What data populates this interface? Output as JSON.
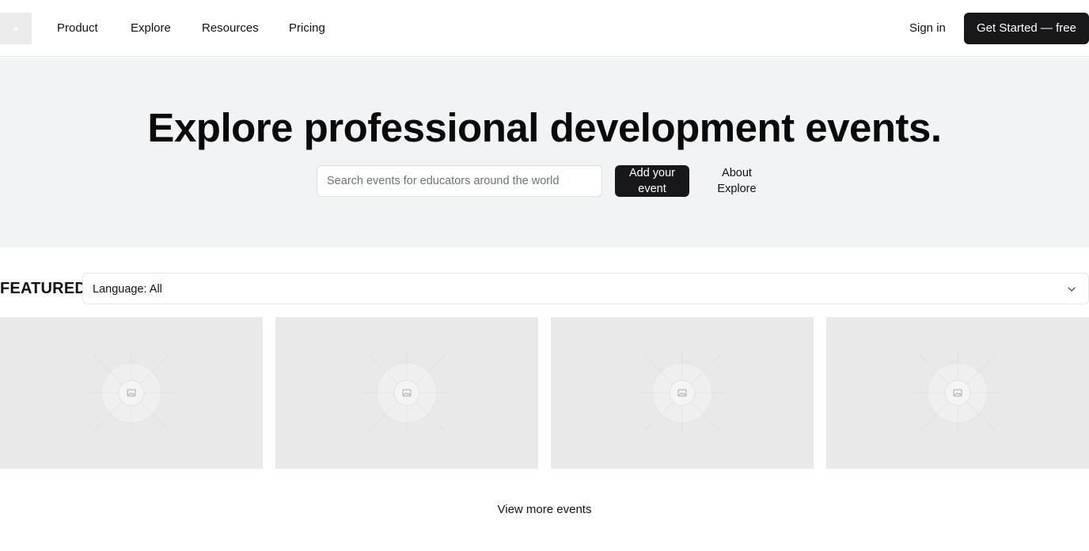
{
  "header": {
    "nav": [
      "Product",
      "Explore",
      "Resources",
      "Pricing"
    ],
    "sign_in": "Sign in",
    "cta": "Get Started — free"
  },
  "hero": {
    "title": "Explore professional development events.",
    "search_placeholder": "Search events for educators around the world",
    "add_event": "Add your event",
    "about": "About Explore"
  },
  "featured": {
    "label": "FEATURED",
    "language_filter": "Language: All",
    "cards": [
      {
        "icon": "image-placeholder-icon"
      },
      {
        "icon": "image-placeholder-icon"
      },
      {
        "icon": "image-placeholder-icon"
      },
      {
        "icon": "image-placeholder-icon"
      }
    ]
  },
  "view_more": "View more events",
  "colors": {
    "primary": "#18181b",
    "hero_bg": "#f1f3f5",
    "card_placeholder": "#e9e9e9"
  }
}
